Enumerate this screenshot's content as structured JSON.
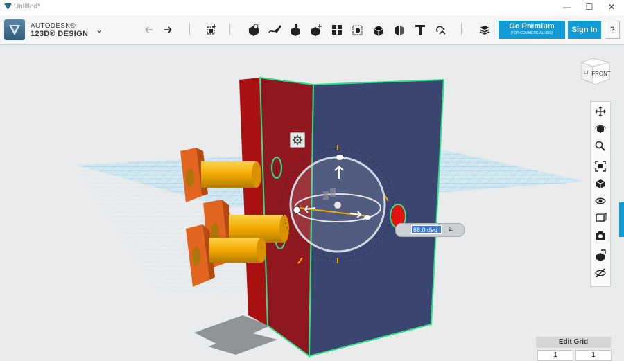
{
  "window": {
    "title": "Untitled*",
    "minimize": "—",
    "maximize": "☐",
    "close": "✕"
  },
  "app": {
    "brand_line1": "AUTODESK®",
    "brand_line2": "123D® DESIGN"
  },
  "toolbar": {
    "undo": "undo-icon",
    "redo": "redo-icon",
    "tools": [
      "transform-icon",
      "primitives-icon",
      "sketch-icon",
      "construct-icon",
      "modify-icon",
      "pattern-icon",
      "grouping-icon",
      "combine-icon",
      "measure-icon",
      "text-icon",
      "snap-icon",
      "materials-icon"
    ],
    "premium_label": "Go Premium",
    "premium_sub": "(FOR COMMERCIAL USE)",
    "signin_label": "Sign In",
    "help_label": "?"
  },
  "viewcube": {
    "face_front": "FRONT",
    "face_left": "LT"
  },
  "manipulator": {
    "angle_value": "88.0 deg"
  },
  "nav_tools": [
    "pan-icon",
    "orbit-icon",
    "zoom-icon",
    "fit-icon",
    "view-mode-icon",
    "visibility-icon",
    "material-icon",
    "screenshot-icon",
    "snap-tool-icon",
    "hide-icon"
  ],
  "grid": {
    "label": "Edit Grid",
    "value_a": "1",
    "value_b": "1"
  },
  "colors": {
    "accent": "#0f9bd7",
    "panel_blue": "#3a4670",
    "panel_red": "#b21818",
    "cylinder": "#f2a900",
    "bracket": "#e2651f",
    "selection": "#2ee28a",
    "grid": "#6cc0e6"
  }
}
